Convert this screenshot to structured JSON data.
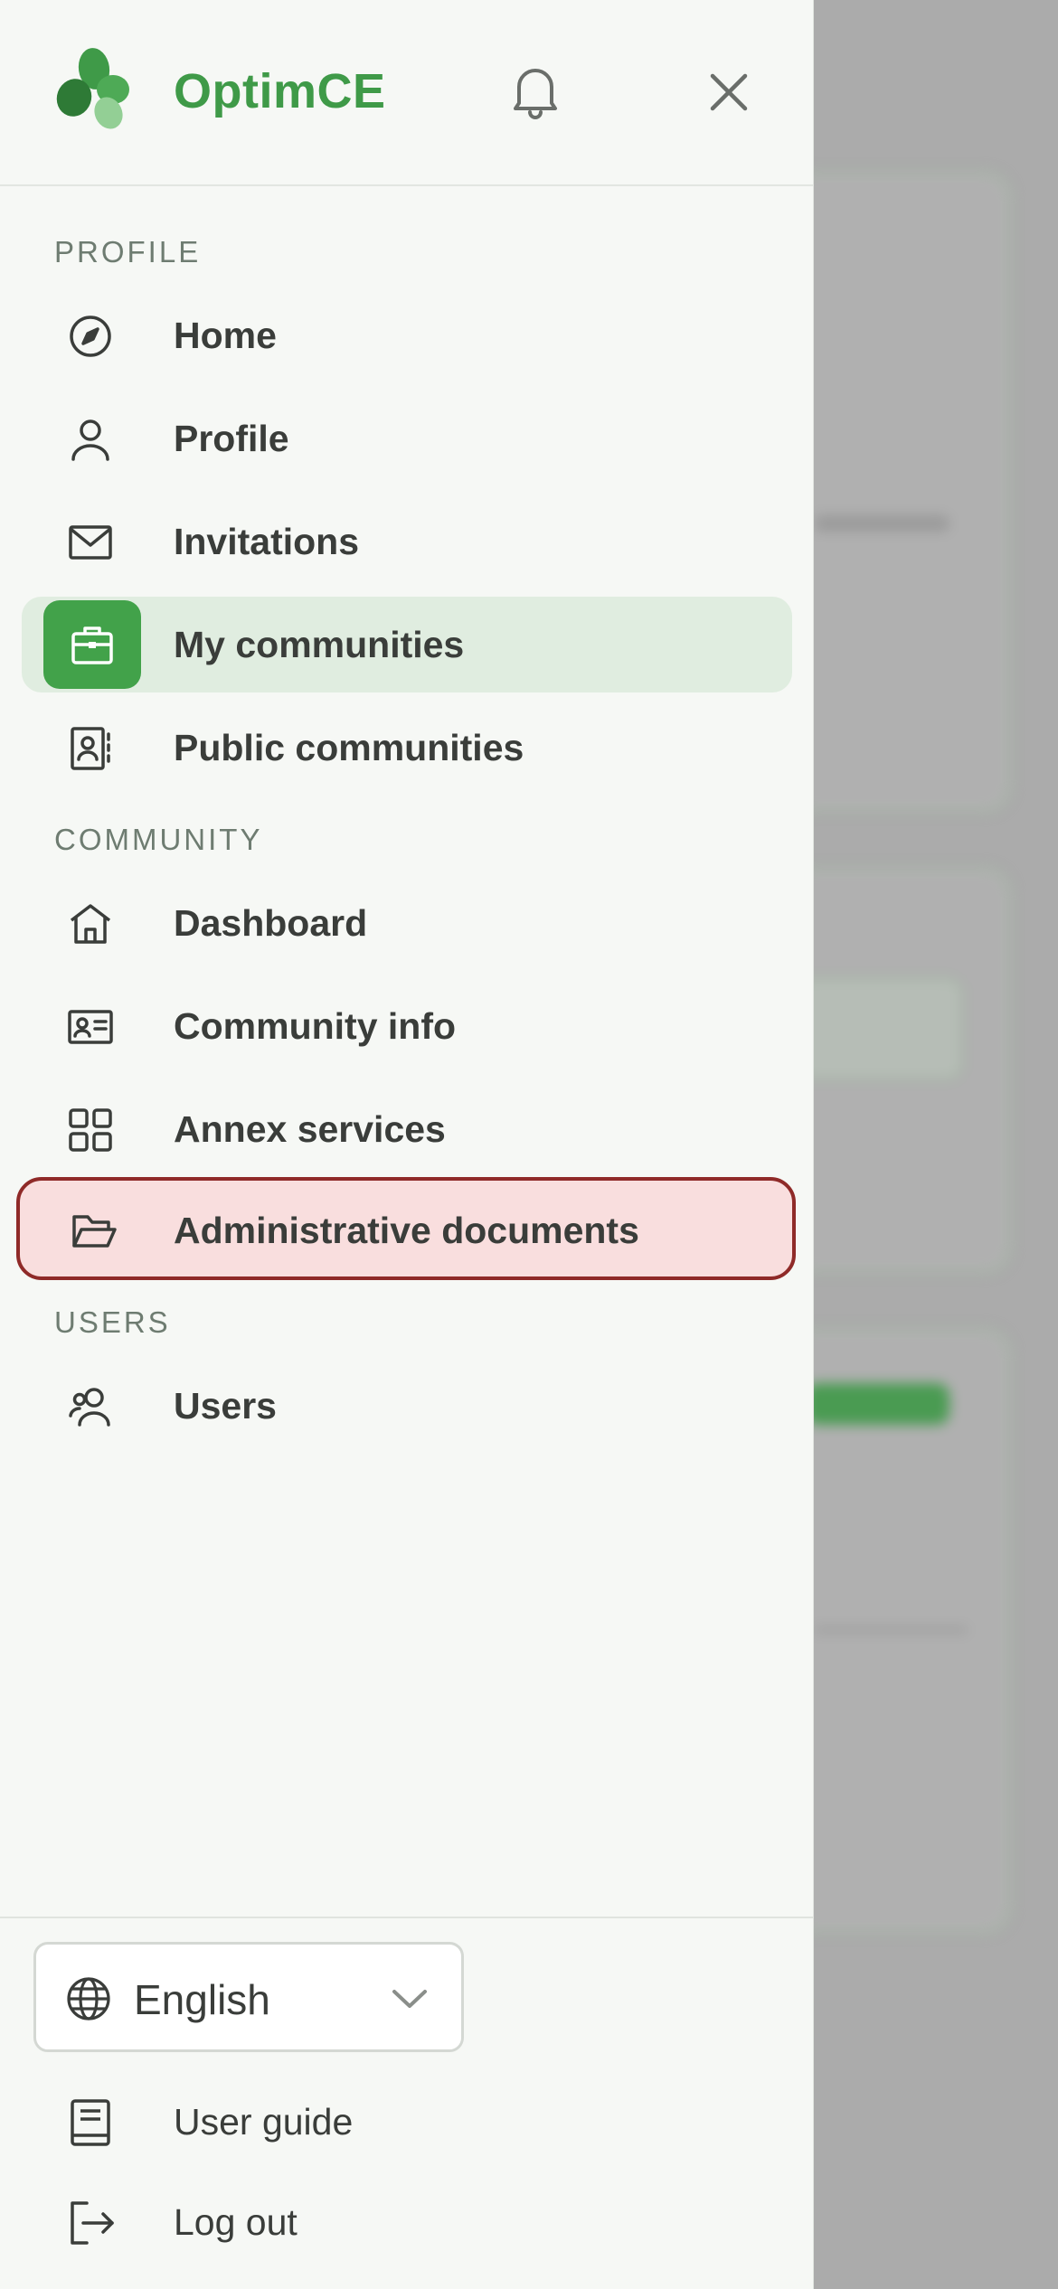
{
  "app": {
    "brand": "OptimCE",
    "accent_color": "#42a24a"
  },
  "header": {
    "notification_icon": "bell-icon",
    "close_icon": "close-icon"
  },
  "sections": {
    "profile": {
      "label": "PROFILE",
      "items": [
        {
          "label": "Home",
          "icon": "compass-icon"
        },
        {
          "label": "Profile",
          "icon": "user-icon"
        },
        {
          "label": "Invitations",
          "icon": "envelope-icon"
        },
        {
          "label": "My communities",
          "icon": "briefcase-icon",
          "active": true
        },
        {
          "label": "Public communities",
          "icon": "contact-book-icon"
        }
      ]
    },
    "community": {
      "label": "COMMUNITY",
      "items": [
        {
          "label": "Dashboard",
          "icon": "house-icon"
        },
        {
          "label": "Community info",
          "icon": "id-card-icon"
        },
        {
          "label": "Annex services",
          "icon": "grid-icon"
        },
        {
          "label": "Administrative documents",
          "icon": "folder-open-icon",
          "highlighted": true
        }
      ]
    },
    "users": {
      "label": "USERS",
      "items": [
        {
          "label": "Users",
          "icon": "users-icon"
        }
      ]
    }
  },
  "footer": {
    "language": {
      "selected": "English",
      "icon": "globe-icon"
    },
    "user_guide": {
      "label": "User guide",
      "icon": "book-icon"
    },
    "logout": {
      "label": "Log out",
      "icon": "logout-icon"
    }
  }
}
